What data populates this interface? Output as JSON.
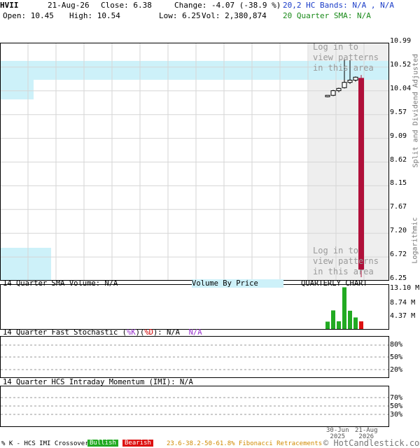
{
  "header": {
    "symbol": "HVII",
    "date": "21-Aug-26",
    "close": "Close: 6.38",
    "change": "Change: -4.07 (-38.9 %)",
    "hc_bands": "20,2 HC Bands: N/A , N/A",
    "open": "Open: 10.45",
    "high": "High: 10.54",
    "low": "Low: 6.25",
    "vol": "Vol: 2,380,874",
    "sma": "20 Quarter SMA: N/A"
  },
  "price_panel": {
    "y_ticks": [
      "10.99",
      "10.52",
      "10.04",
      "9.57",
      "9.09",
      "8.62",
      "8.15",
      "7.67",
      "7.20",
      "6.72",
      "6.25"
    ],
    "right_label_top": "Split and Dividend Adjusted",
    "right_label_bottom": "Logarithmic",
    "watermark_top": [
      "Log in to",
      "view patterns",
      "in this area"
    ],
    "watermark_bottom": [
      "Log in to",
      "view patterns",
      "in this area"
    ]
  },
  "volume_panel": {
    "title_left": "14 Quarter SMA Volume: N/A",
    "title_mid": "Volume By Price",
    "title_right": "QUARTERLY CHART",
    "y_ticks": [
      "13.10 M",
      "8.74 M",
      "4.37 M"
    ]
  },
  "stoch_panel": {
    "title_prefix": "14 Quarter Fast Stochastic (",
    "k_label": "%K",
    "close_paren": ")",
    "open_paren": "(",
    "d_label": "%D",
    "title_suffix": "): N/A",
    "na2": "N/A",
    "y_ticks": [
      "80%",
      "50%",
      "20%"
    ]
  },
  "imi_panel": {
    "title": "14 Quarter HCS Intraday Momentum (IMI): N/A",
    "y_ticks": [
      "70%",
      "50%",
      "30%"
    ]
  },
  "x_axis": {
    "labels": [
      {
        "line1": "30-Jun",
        "line2": "2025"
      },
      {
        "line1": "21-Aug",
        "line2": "2026"
      }
    ]
  },
  "footer": {
    "crossover": "% K - HCS IMI Crossover,",
    "bullish": "Bullish",
    "bearish": "Bearish",
    "fib": "23.6-38.2-50-61.8% Fibonacci Retracements",
    "copyright": "© HotCandlestick.com"
  },
  "colors": {
    "up_candle": "#ffffff",
    "down_candle": "#b0103a",
    "volume_up": "#22aa22",
    "volume_down": "#dd1111",
    "hc_band_fill": "#cdf1f9",
    "bullish": "#22aa22",
    "bearish": "#dd1111"
  },
  "chart_data": [
    {
      "type": "candlestick",
      "title": "HVII",
      "scale": "logarithmic",
      "ylim": [
        6.25,
        10.99
      ],
      "candles": [
        {
          "open": 9.98,
          "high": 10.0,
          "low": 9.95,
          "close": 10.0
        },
        {
          "open": 10.0,
          "high": 10.14,
          "low": 9.98,
          "close": 10.12
        },
        {
          "open": 10.12,
          "high": 10.2,
          "low": 10.08,
          "close": 10.18
        },
        {
          "open": 10.2,
          "high": 10.99,
          "low": 10.18,
          "close": 10.34
        },
        {
          "open": 10.34,
          "high": 10.95,
          "low": 10.3,
          "close": 10.4
        },
        {
          "open": 10.4,
          "high": 10.5,
          "low": 10.36,
          "close": 10.48
        },
        {
          "open": 10.45,
          "high": 10.54,
          "low": 6.25,
          "close": 6.38
        }
      ]
    },
    {
      "type": "bar",
      "title": "Volume",
      "ylim": [
        0,
        13.1
      ],
      "unit": "M",
      "values": [
        2.3,
        5.8,
        2.4,
        13.0,
        5.7,
        3.6,
        2.38
      ],
      "directions": [
        "up",
        "up",
        "up",
        "up",
        "up",
        "up",
        "down"
      ]
    }
  ]
}
